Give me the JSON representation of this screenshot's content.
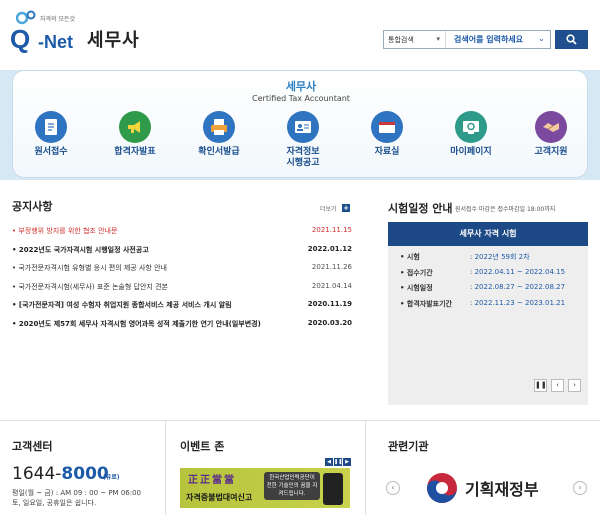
{
  "header": {
    "logo_sub": "자격의 모든것",
    "logo_q": "Q",
    "logo_net": "-Net",
    "site_title": "세무사"
  },
  "search": {
    "type_label": "통합검색",
    "placeholder": "검색어를 입력하세요"
  },
  "banner": {
    "title": "세무사",
    "subtitle": "Certified Tax Accountant",
    "nav": [
      {
        "label": "원서접수",
        "icon": "document-icon",
        "color": "#2f74c0"
      },
      {
        "label": "합격자발표",
        "icon": "megaphone-icon",
        "color": "#2e9a4a"
      },
      {
        "label": "확인서발급",
        "icon": "printer-icon",
        "color": "#2f74c0"
      },
      {
        "label": "자격정보\n시행공고",
        "icon": "id-card-icon",
        "color": "#2f74c0"
      },
      {
        "label": "자료실",
        "icon": "folder-icon",
        "color": "#2f74c0"
      },
      {
        "label": "마이페이지",
        "icon": "monitor-icon",
        "color": "#2e9a8a"
      },
      {
        "label": "고객지원",
        "icon": "handshake-icon",
        "color": "#7b4a9e"
      }
    ]
  },
  "notice": {
    "title": "공지사항",
    "more": "더보기",
    "items": [
      {
        "text": "부정행위 방지를 위한 협조 안내문",
        "date": "2021.11.15",
        "style": "red"
      },
      {
        "text": "2022년도 국가자격시험 시행일정 사전공고",
        "date": "2022.01.12",
        "style": "bold"
      },
      {
        "text": "국가전문자격시험 유형별 응시 편의 제공 사항 안내",
        "date": "2021.11.26",
        "style": "normal"
      },
      {
        "text": "국가전문자격시험(세무사) 표준 논술형 답안지 견본",
        "date": "2021.04.14",
        "style": "normal"
      },
      {
        "text": "[국가전문자격] 여성 수험자 취업지원 종합서비스 제공 서비스 개시 알림",
        "date": "2020.11.19",
        "style": "bold"
      },
      {
        "text": "2020년도 제57회 세무사 자격시험 영어과목 성적 제출기한 연기 안내(일부변경)",
        "date": "2020.03.20",
        "style": "bold"
      }
    ]
  },
  "schedule": {
    "title": "시험일정 안내",
    "note": "원서접수 마감은 접수마감일 18:00까지",
    "box_title": "세무사 자격 시험",
    "rows": [
      {
        "label": "시험",
        "value": "2022년 59회 2차"
      },
      {
        "label": "접수기간",
        "value": "2022.04.11 ~ 2022.04.15"
      },
      {
        "label": "시험일정",
        "value": "2022.08.27 ~ 2022.08.27"
      },
      {
        "label": "합격자발표기간",
        "value": "2022.11.23 ~ 2023.01.21"
      }
    ],
    "ctrl_pause": "❚❚",
    "ctrl_prev": "‹",
    "ctrl_next": "›"
  },
  "customer": {
    "title": "고객센터",
    "phone_prefix": "1644-",
    "phone_suffix": "8000",
    "toll": "(유료)",
    "hours_line1": "평일(월 ~ 금) : AM 09 : 00 ~ PM 06:00",
    "hours_line2": "토, 일요일, 공휴일은 쉽니다."
  },
  "event": {
    "title": "이벤트 존",
    "ctrl_prev": "◀",
    "ctrl_pause": "❚❚",
    "ctrl_next": "▶",
    "banner_big": "正正當當",
    "banner_line": "자격증불법대여신고",
    "banner_right": "한국산업인력공단이 전한 기술인의 꿈을 지켜드립니다."
  },
  "related": {
    "title": "관련기관",
    "org": "기획재정부",
    "prev": "‹",
    "next": "›"
  }
}
